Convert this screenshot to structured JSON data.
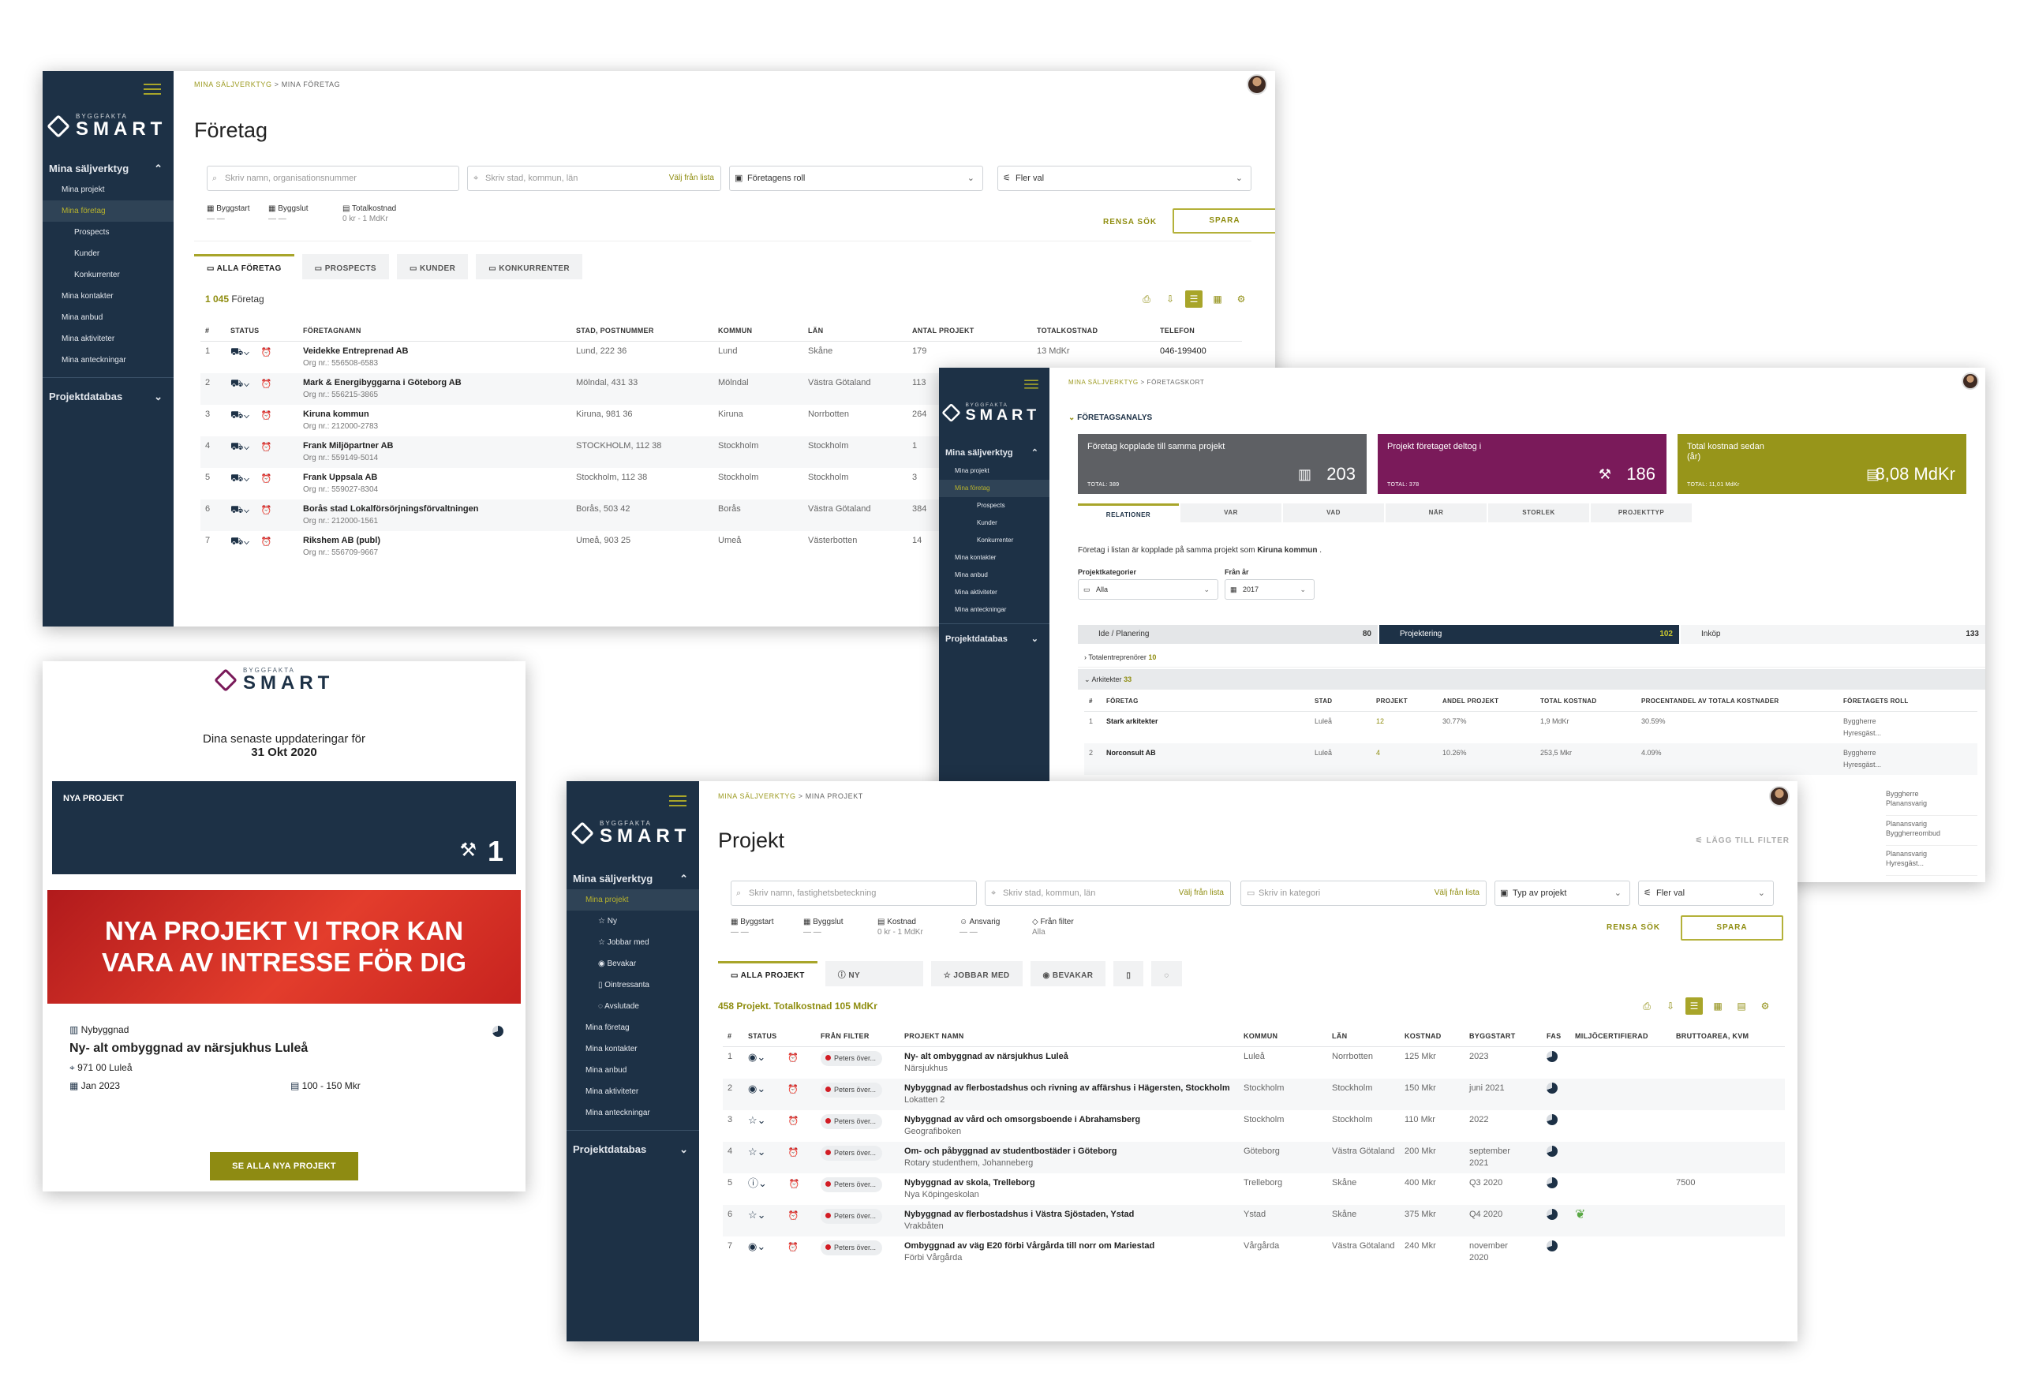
{
  "brand": {
    "small": "BYGGFAKTA",
    "name": "SMART"
  },
  "sidebar_companies": {
    "group": "Mina säljverktyg",
    "items": [
      "Mina projekt",
      "Mina företag",
      "Prospects",
      "Kunder",
      "Konkurrenter",
      "Mina kontakter",
      "Mina anbud",
      "Mina aktiviteter",
      "Mina anteckningar"
    ],
    "db": "Projektdatabas"
  },
  "companies": {
    "crumb1": "MINA SÄLJVERKTYG",
    "crumb2": "MINA FÖRETAG",
    "title": "Företag",
    "search_ph": "Skriv namn, organisationsnummer",
    "city_ph": "Skriv stad, kommun, län",
    "choose_list": "Välj från lista",
    "role": "Företagens roll",
    "more": "Fler val",
    "f_start": "Byggstart",
    "f_end": "Byggslut",
    "f_cost": "Totalkostnad",
    "f_cost_val": "0 kr - 1 MdKr",
    "f_dash": "— —",
    "clear": "RENSA SÖK",
    "save": "SPARA",
    "tabs": [
      "ALLA FÖRETAG",
      "PROSPECTS",
      "KUNDER",
      "KONKURRENTER"
    ],
    "count_n": "1 045",
    "count_t": "Företag",
    "headers": [
      "#",
      "STATUS",
      "FÖRETAGNAMN",
      "STAD, POSTNUMMER",
      "KOMMUN",
      "LÄN",
      "ANTAL PROJEKT",
      "TOTALKOSTNAD",
      "TELEFON"
    ],
    "rows": [
      {
        "n": "1",
        "name": "Veidekke Entreprenad AB",
        "org": "Org nr.: 556508-6583",
        "city": "Lund, 222 36",
        "kommun": "Lund",
        "lan": "Skåne",
        "antal": "179",
        "kost": "13 MdKr",
        "tel": "046-199400"
      },
      {
        "n": "2",
        "name": "Mark & Energibyggarna i Göteborg AB",
        "org": "Org nr.: 556215-3865",
        "city": "Mölndal, 431 33",
        "kommun": "Mölndal",
        "lan": "Västra Götaland",
        "antal": "113",
        "kost": "",
        "tel": ""
      },
      {
        "n": "3",
        "name": "Kiruna kommun",
        "org": "Org nr.: 212000-2783",
        "city": "Kiruna, 981 36",
        "kommun": "Kiruna",
        "lan": "Norrbotten",
        "antal": "264",
        "kost": "",
        "tel": ""
      },
      {
        "n": "4",
        "name": "Frank Miljöpartner AB",
        "org": "Org nr.: 559149-5014",
        "city": "STOCKHOLM, 112 38",
        "kommun": "Stockholm",
        "lan": "Stockholm",
        "antal": "1",
        "kost": "",
        "tel": ""
      },
      {
        "n": "5",
        "name": "Frank Uppsala AB",
        "org": "Org nr.: 559027-8304",
        "city": "Stockholm, 112 38",
        "kommun": "Stockholm",
        "lan": "Stockholm",
        "antal": "3",
        "kost": "",
        "tel": ""
      },
      {
        "n": "6",
        "name": "Borås stad Lokalförsörjningsförvaltningen",
        "org": "Org nr.: 212000-1561",
        "city": "Borås, 503 42",
        "kommun": "Borås",
        "lan": "Västra Götaland",
        "antal": "384",
        "kost": "",
        "tel": ""
      },
      {
        "n": "7",
        "name": "Rikshem AB (publ)",
        "org": "Org nr.: 556709-9667",
        "city": "Umeå, 903 25",
        "kommun": "Umeå",
        "lan": "Västerbotten",
        "antal": "14",
        "kost": "",
        "tel": ""
      }
    ]
  },
  "analysis": {
    "crumb1": "MINA SÄLJVERKTYG",
    "crumb2": "FÖRETAGSKORT",
    "section": "FÖRETAGSANALYS",
    "kpis": [
      {
        "label": "Företag kopplade till samma projekt",
        "total": "TOTAL: 389",
        "value": "203",
        "color": "#5e6064"
      },
      {
        "label": "Projekt företaget deltog i",
        "total": "TOTAL: 378",
        "value": "186",
        "color": "#7a1a5a"
      },
      {
        "label": "Total kostnad sedan (år)",
        "total": "TOTAL: 11,01 MdKr",
        "value": "8,08 MdKr",
        "color": "#97951a"
      }
    ],
    "tabs": [
      "RELATIONER",
      "VAR",
      "VAD",
      "NÄR",
      "STORLEK",
      "PROJEKTTYP"
    ],
    "desc": "Företag i listan är kopplade på samma projekt som",
    "desc_company": "Kiruna kommun",
    "cat_label": "Projektkategorier",
    "cat_val": "Alla",
    "year_label": "Från år",
    "year_val": "2017",
    "stages": [
      {
        "name": "Ide / Planering",
        "n": "80"
      },
      {
        "name": "Projektering",
        "n": "102"
      },
      {
        "name": "Inköp",
        "n": "133"
      }
    ],
    "group1": "Totalentreprenörer",
    "group1_n": "10",
    "group2": "Arkitekter",
    "group2_n": "33",
    "headers": [
      "#",
      "FÖRETAG",
      "STAD",
      "PROJEKT",
      "ANDEL PROJEKT",
      "TOTAL KOSTNAD",
      "PROCENTANDEL AV TOTALA KOSTNADER",
      "FÖRETAGETS ROLL"
    ],
    "rows": [
      {
        "n": "1",
        "name": "Stark arkitekter",
        "stad": "Luleå",
        "proj": "12",
        "andel": "30.77%",
        "kost": "1,9 MdKr",
        "pct": "30.59%",
        "roll": "Byggherre",
        "roll2": "Hyresgäst..."
      },
      {
        "n": "2",
        "name": "Norconsult AB",
        "stad": "Luleå",
        "proj": "4",
        "andel": "10.26%",
        "kost": "253,5 Mkr",
        "pct": "4.09%",
        "roll": "Byggherre",
        "roll2": "Hyresgäst..."
      }
    ],
    "extra_roles": [
      [
        "Byggherre",
        "Planansvarig"
      ],
      [
        "Planansvarig",
        "Byggherreombud"
      ],
      [
        "Planansvarig",
        "Hyresgäst..."
      ]
    ]
  },
  "email": {
    "intro": "Dina senaste uppdateringar för",
    "date": "31 Okt 2020",
    "box_label": "NYA PROJEKT",
    "box_value": "1",
    "hero": "NYA PROJEKT VI TROR KAN VARA AV INTRESSE FÖR DIG",
    "type": "Nybyggnad",
    "project": "Ny- alt ombyggnad av närsjukhus Luleå",
    "address": "971 00 Luleå",
    "start": "Jan 2023",
    "cost": "100 - 150 Mkr",
    "button": "SE ALLA NYA PROJEKT"
  },
  "sidebar_projects": {
    "group": "Mina säljverktyg",
    "items": [
      "Mina projekt",
      "Ny",
      "Jobbar med",
      "Bevakar",
      "Ointressanta",
      "Avslutade",
      "Mina företag",
      "Mina kontakter",
      "Mina anbud",
      "Mina aktiviteter",
      "Mina anteckningar"
    ],
    "db": "Projektdatabas"
  },
  "projects": {
    "crumb1": "MINA SÄLJVERKTYG",
    "crumb2": "MINA PROJEKT",
    "title": "Projekt",
    "add_filter": "LÄGG TILL FILTER",
    "search_ph": "Skriv namn, fastighetsbeteckning",
    "city_ph": "Skriv stad, kommun, län",
    "cat_ph": "Skriv in kategori",
    "choose_list": "Välj från lista",
    "type": "Typ av projekt",
    "more": "Fler val",
    "f_start": "Byggstart",
    "f_end": "Byggslut",
    "f_cost": "Kostnad",
    "f_cost_val": "0 kr - 1 MdKr",
    "f_resp": "Ansvarig",
    "f_filter": "Från filter",
    "f_filter_val": "Alla",
    "f_dash": "— —",
    "clear": "RENSA SÖK",
    "save": "SPARA",
    "tabs": [
      "ALLA PROJEKT",
      "NY",
      "JOBBAR MED",
      "BEVAKAR"
    ],
    "count": "458 Projekt. Totalkostnad",
    "count_v": "105 MdKr",
    "headers": [
      "#",
      "STATUS",
      "FRÅN FILTER",
      "PROJEKT NAMN",
      "KOMMUN",
      "LÄN",
      "KOSTNAD",
      "BYGGSTART",
      "FAS",
      "MILJÖCERTIFIERAD",
      "BRUTTOAREA, KVM"
    ],
    "filter_pill": "Peters över...",
    "rows": [
      {
        "n": "1",
        "name": "Ny- alt ombyggnad av närsjukhus Luleå",
        "sub": "Närsjukhus",
        "kommun": "Luleå",
        "lan": "Norrbotten",
        "kost": "125 Mkr",
        "start": "2023",
        "start2": "",
        "area": "",
        "eco": ""
      },
      {
        "n": "2",
        "name": "Nybyggnad av flerbostadshus och rivning av affärshus i Hägersten, Stockholm",
        "sub": "Lokatten 2",
        "kommun": "Stockholm",
        "lan": "Stockholm",
        "kost": "150 Mkr",
        "start": "juni 2021",
        "start2": "",
        "area": "",
        "eco": ""
      },
      {
        "n": "3",
        "name": "Nybyggnad av vård och omsorgsboende i Abrahamsberg",
        "sub": "Geografiboken",
        "kommun": "Stockholm",
        "lan": "Stockholm",
        "kost": "110 Mkr",
        "start": "2022",
        "start2": "",
        "area": "",
        "eco": ""
      },
      {
        "n": "4",
        "name": "Om- och påbyggnad av studentbostäder i Göteborg",
        "sub": "Rotary studenthem, Johanneberg",
        "kommun": "Göteborg",
        "lan": "Västra Götaland",
        "kost": "200 Mkr",
        "start": "september",
        "start2": "2021",
        "area": "",
        "eco": ""
      },
      {
        "n": "5",
        "name": "Nybyggnad av skola, Trelleborg",
        "sub": "Nya Köpingeskolan",
        "kommun": "Trelleborg",
        "lan": "Skåne",
        "kost": "400 Mkr",
        "start": "Q3 2020",
        "start2": "",
        "area": "7500",
        "eco": ""
      },
      {
        "n": "6",
        "name": "Nybyggnad av flerbostadshus i Västra Sjöstaden, Ystad",
        "sub": "Vrakbåten",
        "kommun": "Ystad",
        "lan": "Skåne",
        "kost": "375 Mkr",
        "start": "Q4 2020",
        "start2": "",
        "area": "",
        "eco": "leaf"
      },
      {
        "n": "7",
        "name": "Ombyggnad av väg E20 förbi Vårgårda till norr om Mariestad",
        "sub": "Förbi Vårgårda",
        "kommun": "Vårgårda",
        "lan": "Västra Götaland",
        "kost": "240 Mkr",
        "start": "november",
        "start2": "2020",
        "area": "",
        "eco": ""
      }
    ]
  }
}
